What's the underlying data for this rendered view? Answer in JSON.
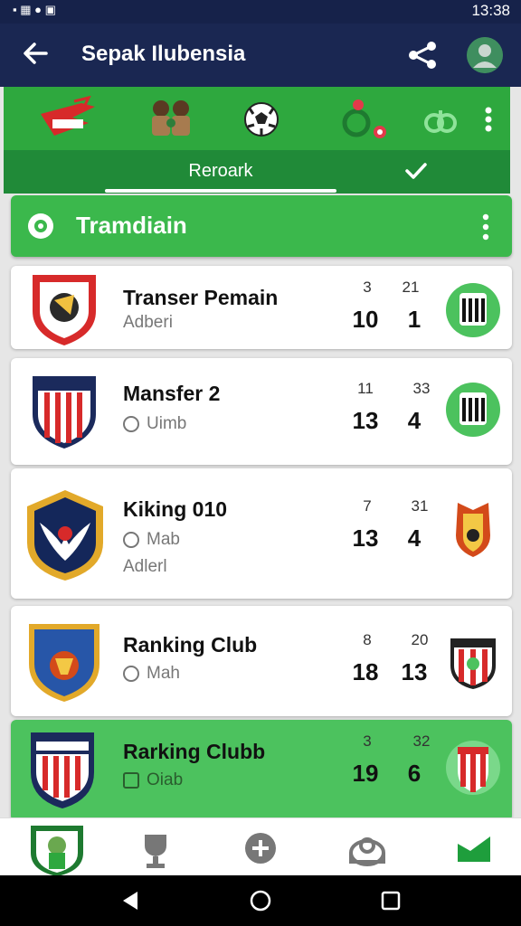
{
  "status_bar": {
    "left_icons": "▪ ▦ ● ▣",
    "time": "13:38"
  },
  "app_bar": {
    "title": "Sepak Ilubensia"
  },
  "tabs": [
    {
      "label": "Reroark",
      "selected": true
    }
  ],
  "section": {
    "title": "Tramdiain"
  },
  "cards": [
    {
      "name": "Transer Pemain",
      "sub": "Adberi",
      "sub2": "",
      "small": [
        "3",
        "21"
      ],
      "big": [
        "10",
        "1"
      ],
      "crest_color": "#d72a2a",
      "highlight": false
    },
    {
      "name": "Mansfer 2",
      "sub": "Uimb",
      "sub2": "",
      "small": [
        "11",
        "33"
      ],
      "big": [
        "13",
        "4"
      ],
      "crest_color": "#1b2a5c",
      "highlight": false
    },
    {
      "name": "Kiking 010",
      "sub": "Mab",
      "sub2": "Adlerl",
      "small": [
        "7",
        "31"
      ],
      "big": [
        "13",
        "4"
      ],
      "crest_color": "#14275a",
      "highlight": false
    },
    {
      "name": "Ranking Club",
      "sub": "Mah",
      "sub2": "",
      "small": [
        "8",
        "20"
      ],
      "big": [
        "18",
        "13"
      ],
      "crest_color": "#2756a8",
      "highlight": false
    },
    {
      "name": "Rarking Clubb",
      "sub": "Oiab",
      "sub2": "",
      "small": [
        "3",
        "32"
      ],
      "big": [
        "19",
        "6"
      ],
      "crest_color": "#1b2a5c",
      "highlight": true
    }
  ],
  "colors": {
    "app_bar": "#1a2752",
    "green": "#2ea83e",
    "highlight": "#4cc25e"
  }
}
